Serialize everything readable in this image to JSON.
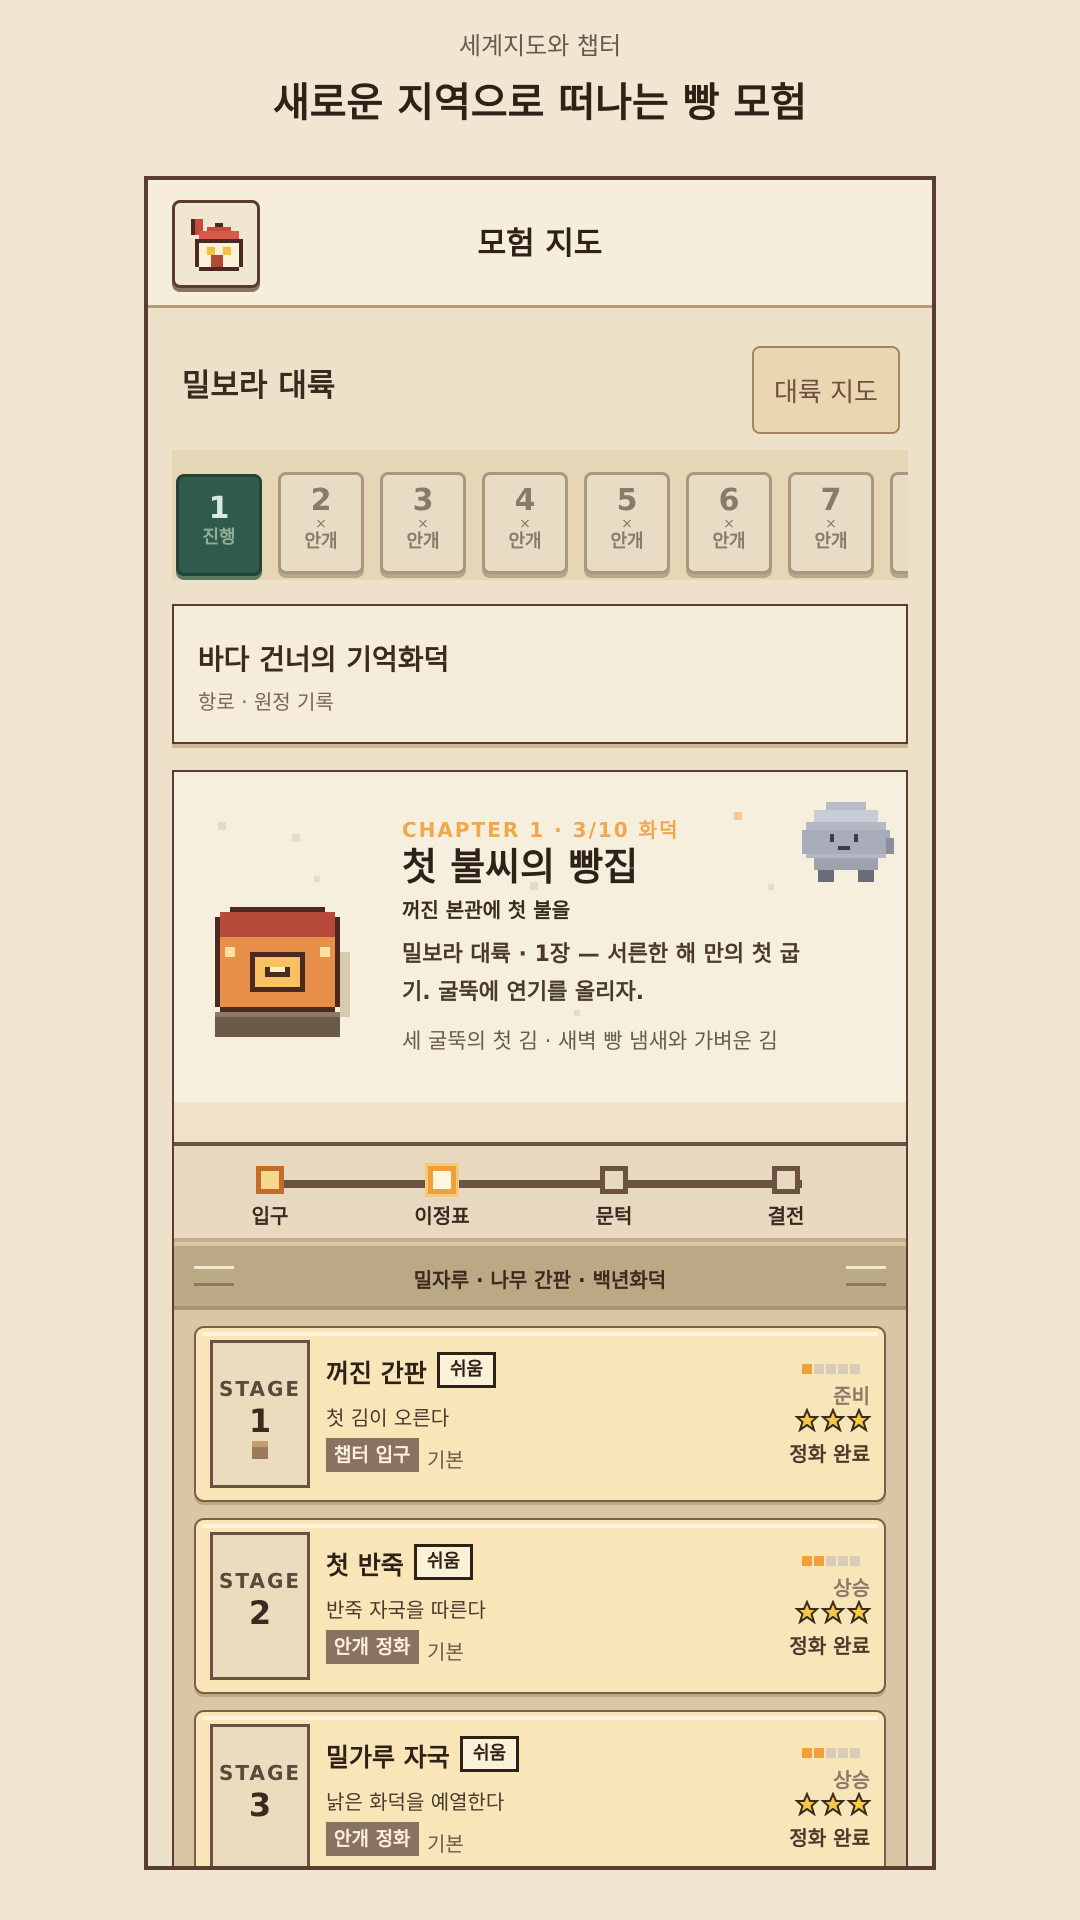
{
  "page": {
    "subtitle": "세계지도와 챕터",
    "title": "새로운 지역으로 떠나는 빵 모험"
  },
  "topbar": {
    "home_icon": "bakery-house-icon",
    "title": "모험 지도"
  },
  "region": {
    "name": "밀보라 대륙",
    "continent_button": "대륙 지도"
  },
  "chapter_tabs": [
    {
      "num": "1",
      "mark": "",
      "label": "진행",
      "active": true
    },
    {
      "num": "2",
      "mark": "×",
      "label": "안개",
      "active": false
    },
    {
      "num": "3",
      "mark": "×",
      "label": "안개",
      "active": false
    },
    {
      "num": "4",
      "mark": "×",
      "label": "안개",
      "active": false
    },
    {
      "num": "5",
      "mark": "×",
      "label": "안개",
      "active": false
    },
    {
      "num": "6",
      "mark": "×",
      "label": "안개",
      "active": false
    },
    {
      "num": "7",
      "mark": "×",
      "label": "안개",
      "active": false
    }
  ],
  "memory_card": {
    "title": "바다 건너의 기억화덕",
    "subtitle": "항로 · 원정 기록"
  },
  "chapter": {
    "label": "CHAPTER 1 · 3/10 화덕",
    "title": "첫 불씨의 빵집",
    "subtitle": "꺼진 본관에 첫 불을",
    "description": "밀보라 대륙 · 1장 — 서른한 해 만의 첫 굽기. 굴뚝에 연기를 올리자.",
    "note": "세 굴뚝의 첫 김 · 새벽 빵 냄새와 가벼운 김",
    "illustration_icon": "bakery-oven-icon",
    "mascot_icon": "dough-golem-icon"
  },
  "progress_nodes": [
    {
      "label": "입구",
      "state": "done"
    },
    {
      "label": "이정표",
      "state": "current"
    },
    {
      "label": "문턱",
      "state": "locked"
    },
    {
      "label": "결전",
      "state": "locked"
    }
  ],
  "location": "밀자루 · 나무 간판 · 백년화덕",
  "stages": [
    {
      "stage_label": "STAGE",
      "num": "1",
      "name": "꺼진 간판",
      "difficulty": "쉬움",
      "desc": "첫 김이 오른다",
      "tag": "챕터 입구",
      "type": "기본",
      "meter_level": 1,
      "meter_max": 5,
      "status": "준비",
      "stars": 3,
      "completion": "정화 완료"
    },
    {
      "stage_label": "STAGE",
      "num": "2",
      "name": "첫 반죽",
      "difficulty": "쉬움",
      "desc": "반죽 자국을 따른다",
      "tag": "안개 정화",
      "type": "기본",
      "meter_level": 2,
      "meter_max": 5,
      "status": "상승",
      "stars": 3,
      "completion": "정화 완료"
    },
    {
      "stage_label": "STAGE",
      "num": "3",
      "name": "밀가루 자국",
      "difficulty": "쉬움",
      "desc": "낡은 화덕을 예열한다",
      "tag": "안개 정화",
      "type": "기본",
      "meter_level": 2,
      "meter_max": 5,
      "status": "상승",
      "stars": 3,
      "completion": "정화 완료"
    }
  ],
  "colors": {
    "background": "#f1e6d2",
    "frame_border": "#5a3d30",
    "active_tab": "#2f5a4c",
    "accent_orange": "#f0a03a",
    "stage_card": "#f8e6b8"
  }
}
